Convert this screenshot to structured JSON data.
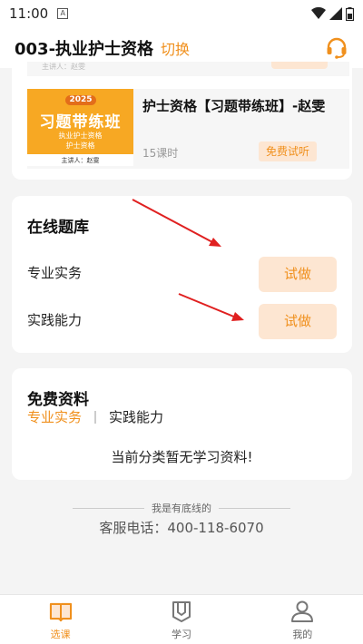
{
  "status_bar": {
    "time": "11:00",
    "sim_label": "A"
  },
  "header": {
    "title": "003-执业护士资格",
    "switch_label": "切换",
    "support_icon": "headset-icon"
  },
  "course": {
    "previous_item_text": "主讲人：赵雯",
    "thumbnail": {
      "year": "2025",
      "headline": "习题带练班",
      "line1": "执业护士资格",
      "line2": "护士资格",
      "lecturer": "主讲人：赵雯"
    },
    "title": "护士资格【习题带练班】-赵雯",
    "lessons": "15课时",
    "trial_label": "免费试听"
  },
  "question_bank": {
    "title": "在线题库",
    "items": [
      {
        "label": "专业实务",
        "button": "试做"
      },
      {
        "label": "实践能力",
        "button": "试做"
      }
    ]
  },
  "free_materials": {
    "title": "免费资料",
    "tabs": [
      {
        "label": "专业实务"
      },
      {
        "label": "实践能力"
      }
    ],
    "empty_message": "当前分类暂无学习资料!"
  },
  "footer": {
    "bottom_line": "我是有底线的",
    "hotline": "客服电话：400-118-6070"
  },
  "tabbar": {
    "items": [
      {
        "label": "选课",
        "icon": "book-icon",
        "active": true
      },
      {
        "label": "学习",
        "icon": "study-icon",
        "active": false
      },
      {
        "label": "我的",
        "icon": "user-icon",
        "active": false
      }
    ]
  },
  "colors": {
    "accent": "#f0901d",
    "accent_bg": "#fde6d2",
    "thumb_orange": "#f7a823",
    "arrow_red": "#e02020"
  }
}
